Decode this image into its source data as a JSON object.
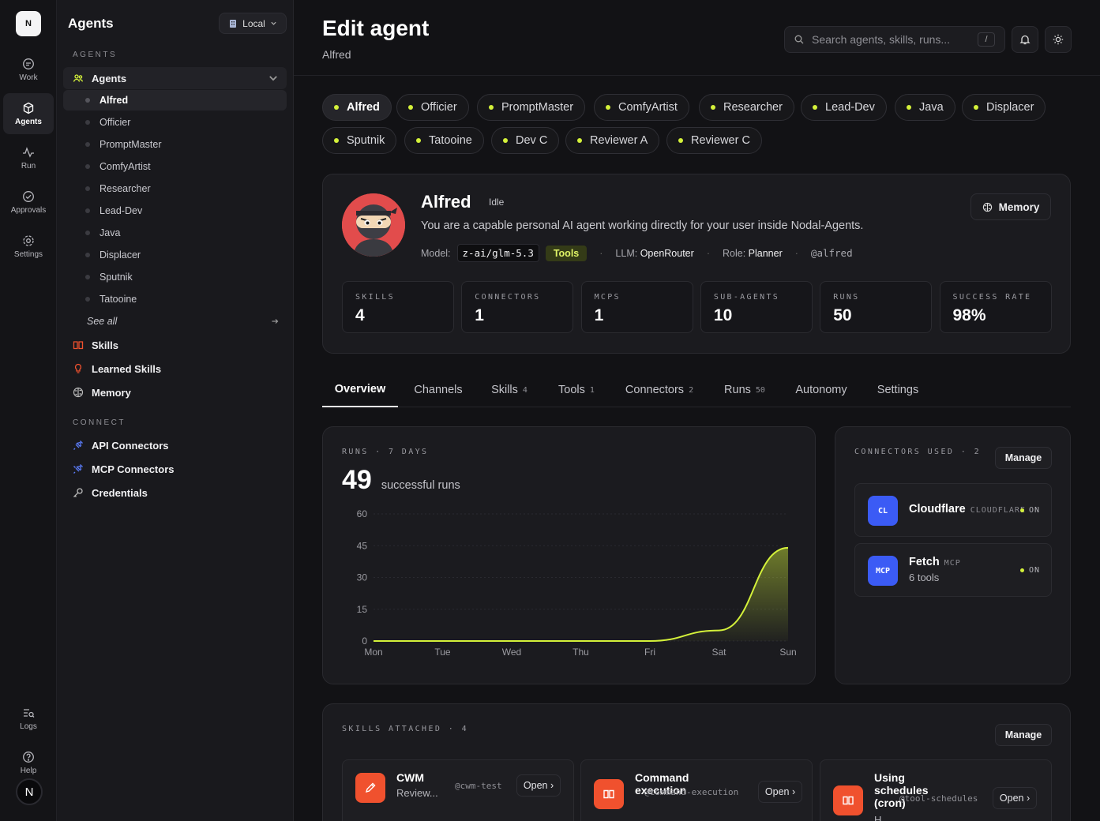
{
  "rail": {
    "logo": "N",
    "items": [
      {
        "label": "Work",
        "icon": "chat-icon"
      },
      {
        "label": "Agents",
        "icon": "cube-icon"
      },
      {
        "label": "Run",
        "icon": "activity-icon"
      },
      {
        "label": "Approvals",
        "icon": "check-circle-icon"
      },
      {
        "label": "Settings",
        "icon": "gear-icon"
      }
    ],
    "bottom": [
      {
        "label": "Logs",
        "icon": "logs-icon"
      },
      {
        "label": "Help",
        "icon": "help-icon"
      }
    ],
    "user_initial": "N"
  },
  "sidebar": {
    "title": "Agents",
    "env_label": "Local",
    "agents_section": "AGENTS",
    "agents_group": "Agents",
    "agents": [
      "Alfred",
      "Officier",
      "PromptMaster",
      "ComfyArtist",
      "Researcher",
      "Lead-Dev",
      "Java",
      "Displacer",
      "Sputnik",
      "Tatooine"
    ],
    "see_all": "See all",
    "nav": [
      "Skills",
      "Learned Skills",
      "Memory"
    ],
    "connect_section": "CONNECT",
    "connect": [
      "API Connectors",
      "MCP Connectors",
      "Credentials"
    ]
  },
  "header": {
    "title": "Edit agent",
    "subtitle": "Alfred",
    "search_placeholder": "Search agents, skills, runs...",
    "search_shortcut": "/"
  },
  "agent_chips": [
    "Alfred",
    "Officier",
    "PromptMaster",
    "ComfyArtist",
    "Researcher",
    "Lead-Dev",
    "Java",
    "Displacer",
    "Sputnik",
    "Tatooine",
    "Dev C",
    "Reviewer A",
    "Reviewer C"
  ],
  "agent": {
    "name": "Alfred",
    "status": "Idle",
    "description": "You are a capable personal AI agent working directly for your user inside Nodal-Agents.",
    "model_label": "Model:",
    "model": "z-ai/glm-5.3",
    "tools_badge": "Tools",
    "llm_label": "LLM:",
    "llm": "OpenRouter",
    "role_label": "Role:",
    "role": "Planner",
    "handle": "@alfred",
    "memory_button": "Memory",
    "stats": [
      {
        "label": "SKILLS",
        "value": "4"
      },
      {
        "label": "CONNECTORS",
        "value": "1"
      },
      {
        "label": "MCPS",
        "value": "1"
      },
      {
        "label": "SUB-AGENTS",
        "value": "10"
      },
      {
        "label": "RUNS",
        "value": "50"
      },
      {
        "label": "SUCCESS RATE",
        "value": "98%"
      }
    ]
  },
  "tabs": [
    {
      "label": "Overview",
      "count": ""
    },
    {
      "label": "Channels",
      "count": ""
    },
    {
      "label": "Skills",
      "count": "4"
    },
    {
      "label": "Tools",
      "count": "1"
    },
    {
      "label": "Connectors",
      "count": "2"
    },
    {
      "label": "Runs",
      "count": "50"
    },
    {
      "label": "Autonomy",
      "count": ""
    },
    {
      "label": "Settings",
      "count": ""
    }
  ],
  "runs_card": {
    "label": "RUNS · 7 DAYS",
    "big_value": "49",
    "big_caption": "successful runs"
  },
  "chart_data": {
    "type": "area",
    "categories": [
      "Mon",
      "Tue",
      "Wed",
      "Thu",
      "Fri",
      "Sat",
      "Sun"
    ],
    "values": [
      0,
      0,
      0,
      0,
      0,
      5,
      44
    ],
    "ylim": [
      0,
      60
    ],
    "yticks": [
      "0",
      "15",
      "30",
      "45",
      "60"
    ],
    "grid": true,
    "line_color": "#d4f13a"
  },
  "connectors_card": {
    "label": "CONNECTORS USED · 2",
    "manage": "Manage",
    "items": [
      {
        "badge": "CL",
        "name": "Cloudflare",
        "kind": "CLOUDFLARE",
        "sub": "",
        "status": "ON"
      },
      {
        "badge": "MCP",
        "name": "Fetch",
        "kind": "MCP",
        "sub": "6 tools",
        "status": "ON"
      }
    ]
  },
  "skills_card": {
    "label": "SKILLS ATTACHED · 4",
    "manage": "Manage",
    "items": [
      {
        "name": "CWM",
        "desc": "Review...",
        "slug": "@cwm-test",
        "open": "Open ›"
      },
      {
        "name": "Command execution",
        "desc": "",
        "slug": "@command-execution",
        "open": "Open ›"
      },
      {
        "name": "Using schedules (cron)",
        "desc": "H...",
        "slug": "@tool-schedules",
        "open": "Open ›"
      }
    ]
  },
  "colors": {
    "accent": "#d4f13a",
    "connector_blue": "#3b5bf5",
    "skill_orange": "#f0512e"
  }
}
